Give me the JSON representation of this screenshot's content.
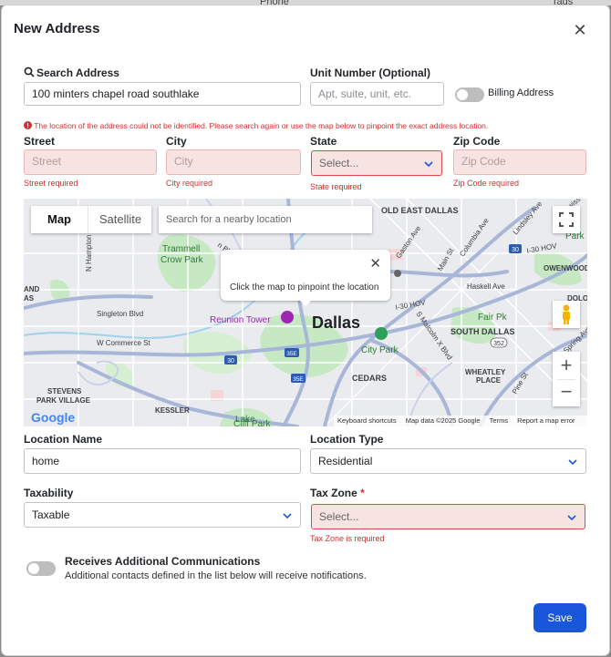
{
  "background": {
    "fragment_left": "Phone",
    "fragment_right": "Tags"
  },
  "modal": {
    "title": "New Address"
  },
  "search": {
    "label": "Search Address",
    "value": "100 minters chapel road southlake"
  },
  "unit": {
    "label": "Unit Number (Optional)",
    "placeholder": "Apt, suite, unit, etc."
  },
  "billing": {
    "label": "Billing Address"
  },
  "error_banner": "The location of the address could not be identified. Please search again or use the map below to pinpoint the exact address location.",
  "street": {
    "label": "Street",
    "placeholder": "Street",
    "error": "Street required"
  },
  "city": {
    "label": "City",
    "placeholder": "City",
    "error": "City required"
  },
  "state": {
    "label": "State",
    "value": "Select...",
    "error": "State required"
  },
  "zip": {
    "label": "Zip Code",
    "placeholder": "Zip Code",
    "error": "Zip Code required"
  },
  "map": {
    "tab_map": "Map",
    "tab_satellite": "Satellite",
    "search_placeholder": "Search for a nearby location",
    "tooltip": "Click the map to pinpoint the location",
    "city_label": "Dallas",
    "places": {
      "old_east_dallas": "OLD EAST DALLAS",
      "trammell": "Trammell",
      "crow_park": "Crow Park",
      "reunion_tower": "Reunion Tower",
      "singleton": "Singleton Blvd",
      "w_commerce": "W Commerce St",
      "stevens": "STEVENS",
      "park_village": "PARK VILLAGE",
      "kessler": "KESSLER",
      "lake": "Lake",
      "cliff_park": "Cliff Park",
      "city_park": "City Park",
      "cedars": "CEDARS",
      "fair_pk": "Fair Pk",
      "south_dallas": "SOUTH DALLAS",
      "wheatley": "WHEATLEY",
      "place": "PLACE",
      "owenwood": "OWENWOOD",
      "haskell": "Haskell Ave",
      "main_st": "Main St",
      "gaston": "Gaston Ave",
      "columbia": "Columbia Ave",
      "lindsley": "Lindsley Ave",
      "swiss": "Swiss Ave",
      "dolo": "DOLO",
      "ands": "AND",
      "as": "AS",
      "park_r": "Park",
      "hampton": "N Hampton",
      "malcolm": "S Malcolm X Blvd",
      "spring": "Spring Ave",
      "pine": "Pine St",
      "hov": "I-30 HOV",
      "hov2": "I-30 HOV",
      "n_blvd": "n Blvd"
    },
    "shields": {
      "i30a": "30",
      "i30b": "30",
      "i35e": "35E",
      "i35e_b": "35E",
      "r352": "352"
    },
    "footer": {
      "logo": "Google",
      "shortcuts": "Keyboard shortcuts",
      "mapdata": "Map data ©2025 Google",
      "terms": "Terms",
      "report": "Report a map error"
    }
  },
  "location_name": {
    "label": "Location Name",
    "value": "home"
  },
  "location_type": {
    "label": "Location Type",
    "value": "Residential"
  },
  "taxability": {
    "label": "Taxability",
    "value": "Taxable"
  },
  "tax_zone": {
    "label": "Tax Zone",
    "required_mark": "*",
    "value": "Select...",
    "error": "Tax Zone is required"
  },
  "communications": {
    "title": "Receives Additional Communications",
    "description": "Additional contacts defined in the list below will receive notifications."
  },
  "save_label": "Save",
  "colors": {
    "primary": "#1a56db",
    "error": "#d32f2f",
    "error_bg": "#f8e3e3",
    "map_green": "#c6e9c4",
    "road": "#aeb9d6"
  }
}
